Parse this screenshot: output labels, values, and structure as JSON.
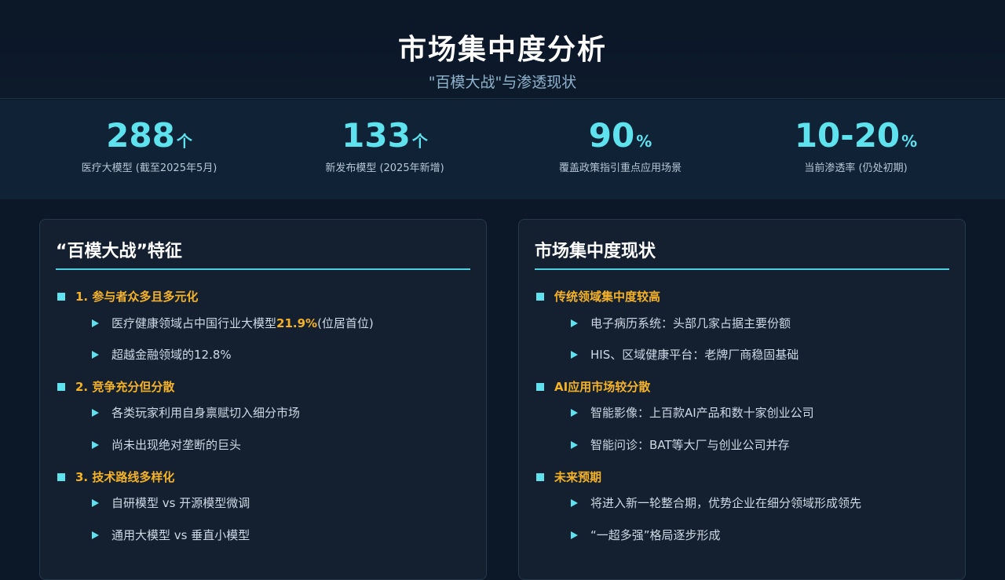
{
  "header": {
    "title": "市场集中度分析",
    "subtitle": "\"百模大战\"与渗透现状"
  },
  "stats": [
    {
      "value": "288",
      "unit": "个",
      "label": "医疗大模型 (截至2025年5月)"
    },
    {
      "value": "133",
      "unit": "个",
      "label": "新发布模型 (2025年新增)"
    },
    {
      "value": "90",
      "unit": "%",
      "label": "覆盖政策指引重点应用场景"
    },
    {
      "value": "10-20",
      "unit": "%",
      "label": "当前渗透率 (仍处初期)"
    }
  ],
  "left_panel": {
    "title": "“百模大战”特征",
    "sections": [
      {
        "heading": "1. 参与者众多且多元化",
        "items": [
          {
            "pre": "医疗健康领域占中国行业大模型",
            "highlight": "21.9%",
            "post": " (位居首位)"
          },
          {
            "text": "超越金融领域的12.8%"
          }
        ]
      },
      {
        "heading": "2. 竞争充分但分散",
        "items": [
          {
            "text": "各类玩家利用自身禀赋切入细分市场"
          },
          {
            "text": "尚未出现绝对垄断的巨头"
          }
        ]
      },
      {
        "heading": "3. 技术路线多样化",
        "items": [
          {
            "text": "自研模型 vs 开源模型微调"
          },
          {
            "text": "通用大模型 vs 垂直小模型"
          }
        ]
      }
    ]
  },
  "right_panel": {
    "title": "市场集中度现状",
    "sections": [
      {
        "heading": "传统领域集中度较高",
        "items": [
          {
            "text": "电子病历系统：头部几家占据主要份额"
          },
          {
            "text": "HIS、区域健康平台：老牌厂商稳固基础"
          }
        ]
      },
      {
        "heading": "AI应用市场较分散",
        "items": [
          {
            "text": "智能影像：上百款AI产品和数十家创业公司"
          },
          {
            "text": "智能问诊：BAT等大厂与创业公司并存"
          }
        ]
      },
      {
        "heading": "未来预期",
        "items": [
          {
            "text": "将进入新一轮整合期，优势企业在细分领域形成领先"
          },
          {
            "text": "“一超多强”格局逐步形成"
          }
        ]
      }
    ]
  },
  "colors": {
    "accent": "#5ee3ee",
    "highlight": "#f5b324",
    "background": "#0c1828",
    "panel": "#142030"
  }
}
